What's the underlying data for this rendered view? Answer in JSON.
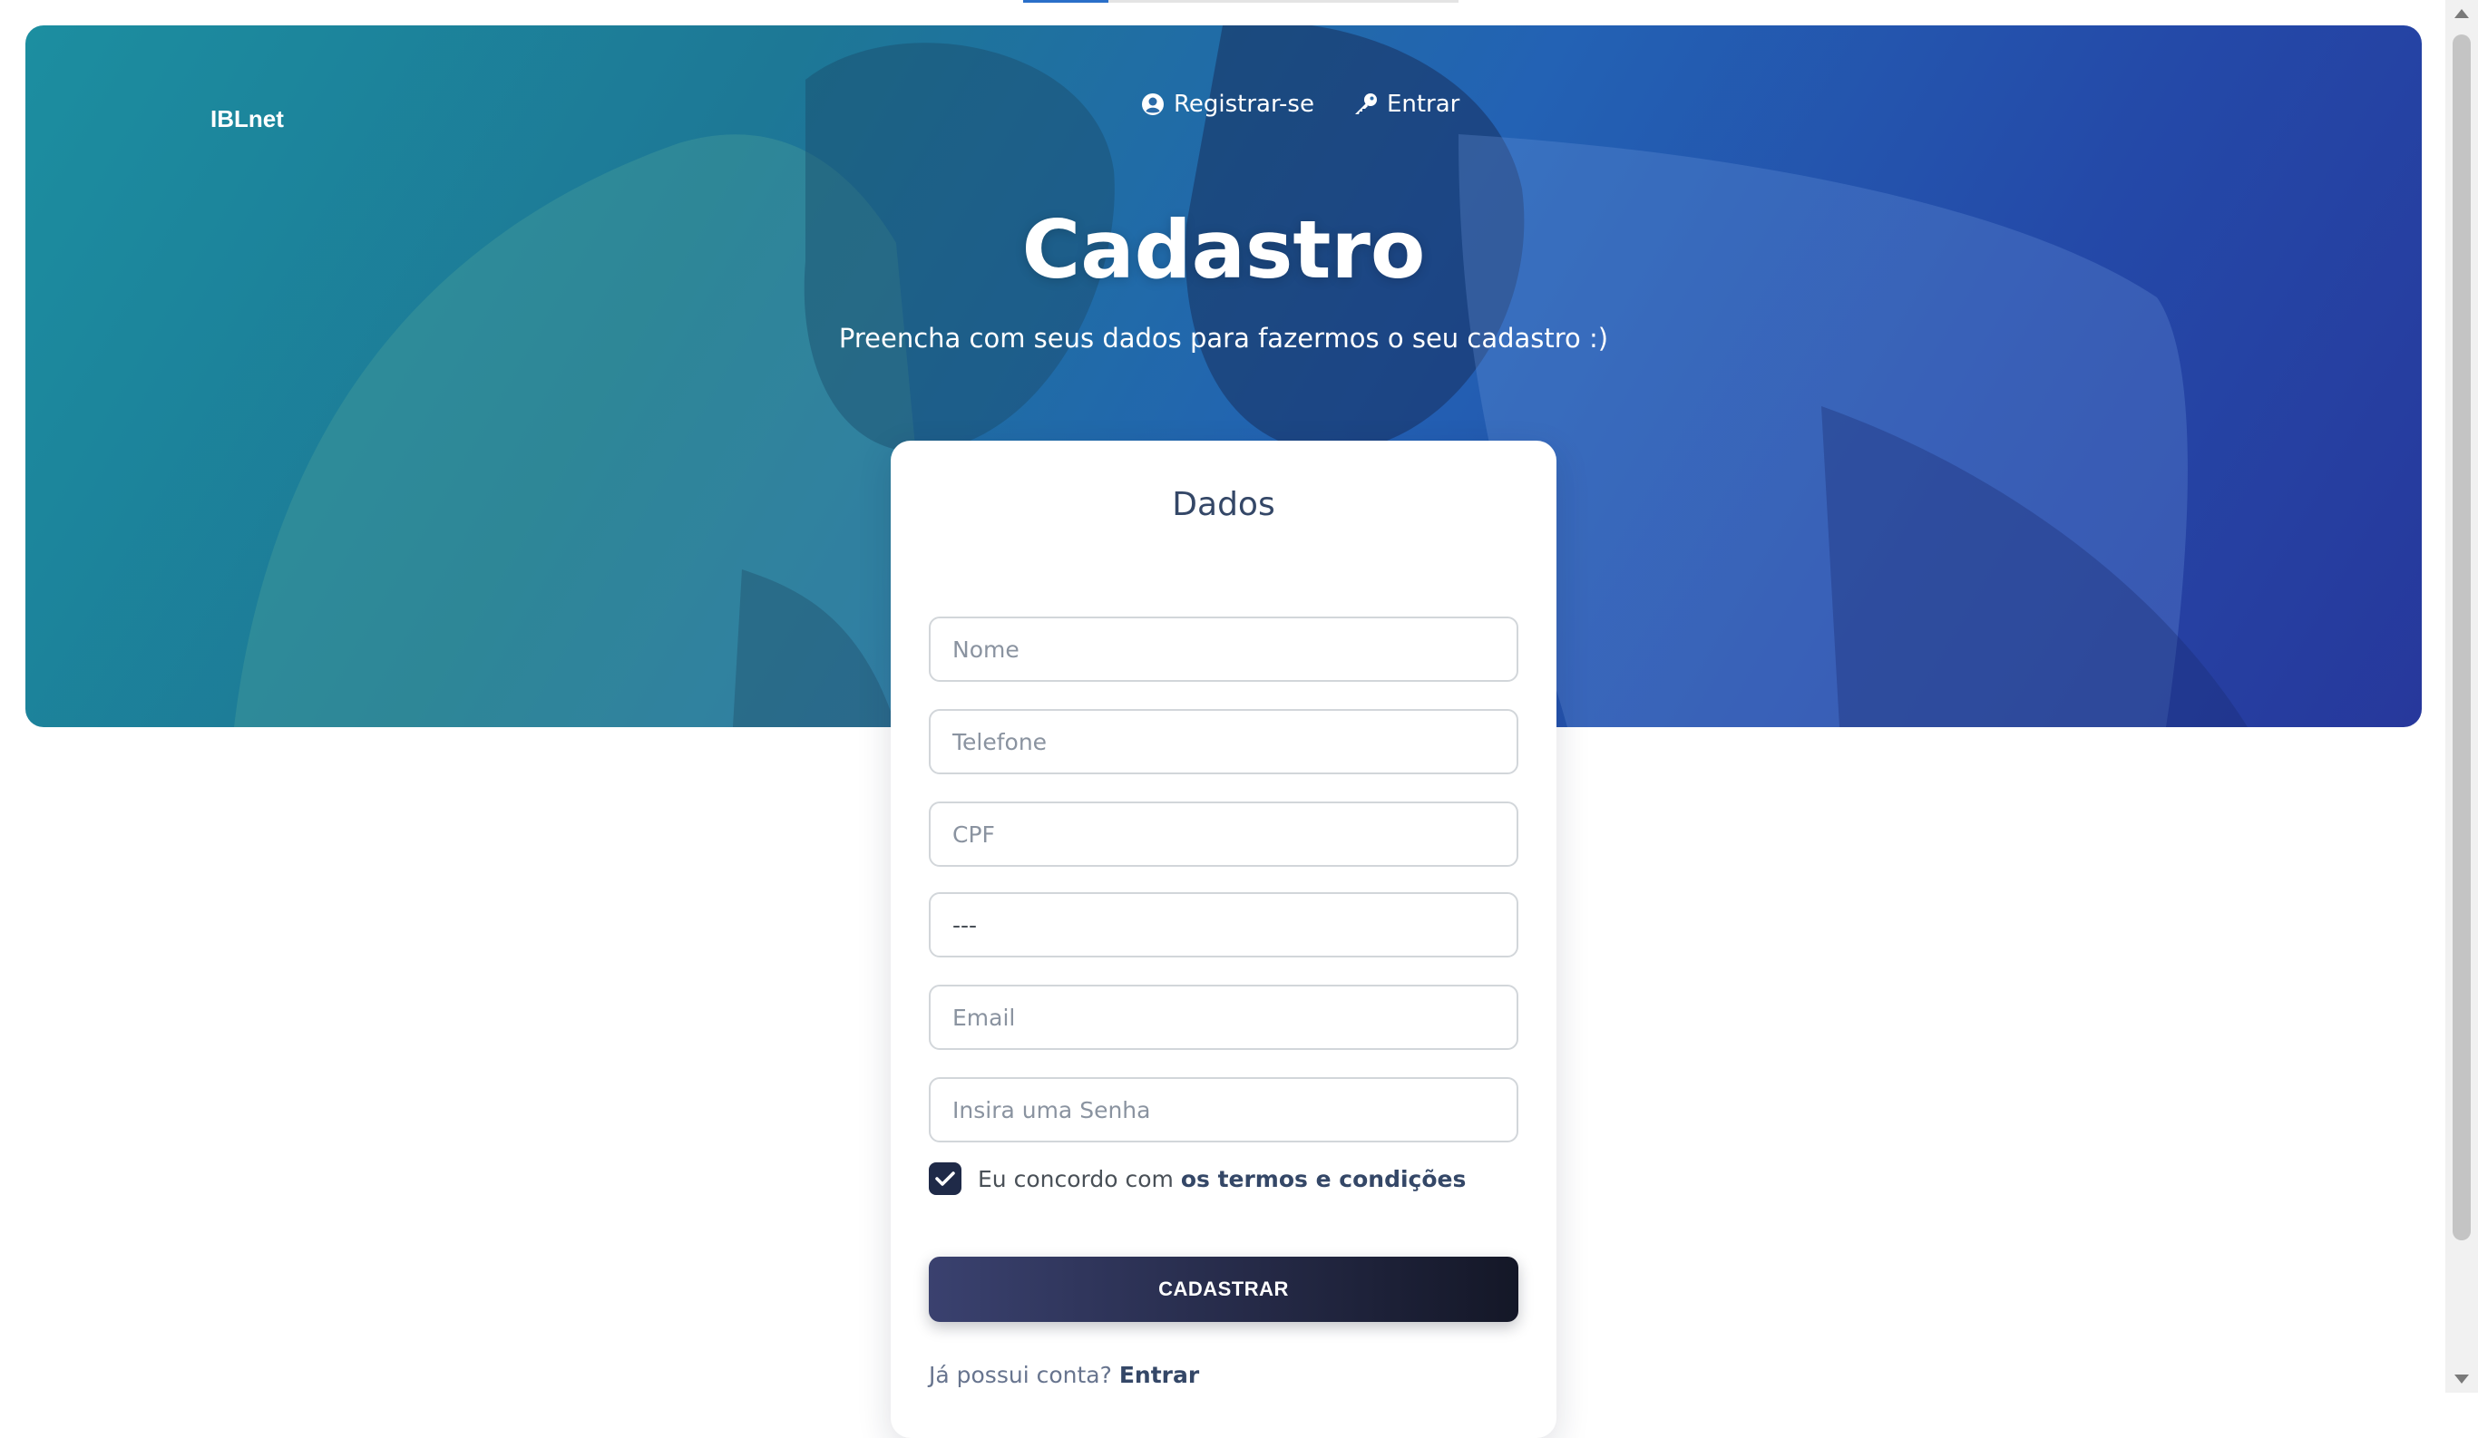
{
  "brand": "IBLnet",
  "nav": {
    "register_label": "Registrar-se",
    "login_label": "Entrar"
  },
  "hero": {
    "title": "Cadastro",
    "subtitle": "Preencha com seus dados para fazermos o seu cadastro :)"
  },
  "form": {
    "title": "Dados",
    "fields": {
      "name_placeholder": "Nome",
      "phone_placeholder": "Telefone",
      "cpf_placeholder": "CPF",
      "select_value": "---",
      "email_placeholder": "Email",
      "password_placeholder": "Insira uma Senha"
    },
    "terms_checked": true,
    "terms_prefix": "Eu concordo com",
    "terms_link": "os termos e condições",
    "submit_label": "CADASTRAR",
    "login_prompt": "Já possui conta?",
    "login_link": "Entrar"
  },
  "colors": {
    "hero_teal": "#1c8ea0",
    "hero_blue": "#27389c",
    "button_dark": "#141727",
    "checkbox": "#1f2a48"
  },
  "icons": {
    "register": "user-circle-icon",
    "login": "key-icon",
    "checkbox": "check-icon"
  }
}
